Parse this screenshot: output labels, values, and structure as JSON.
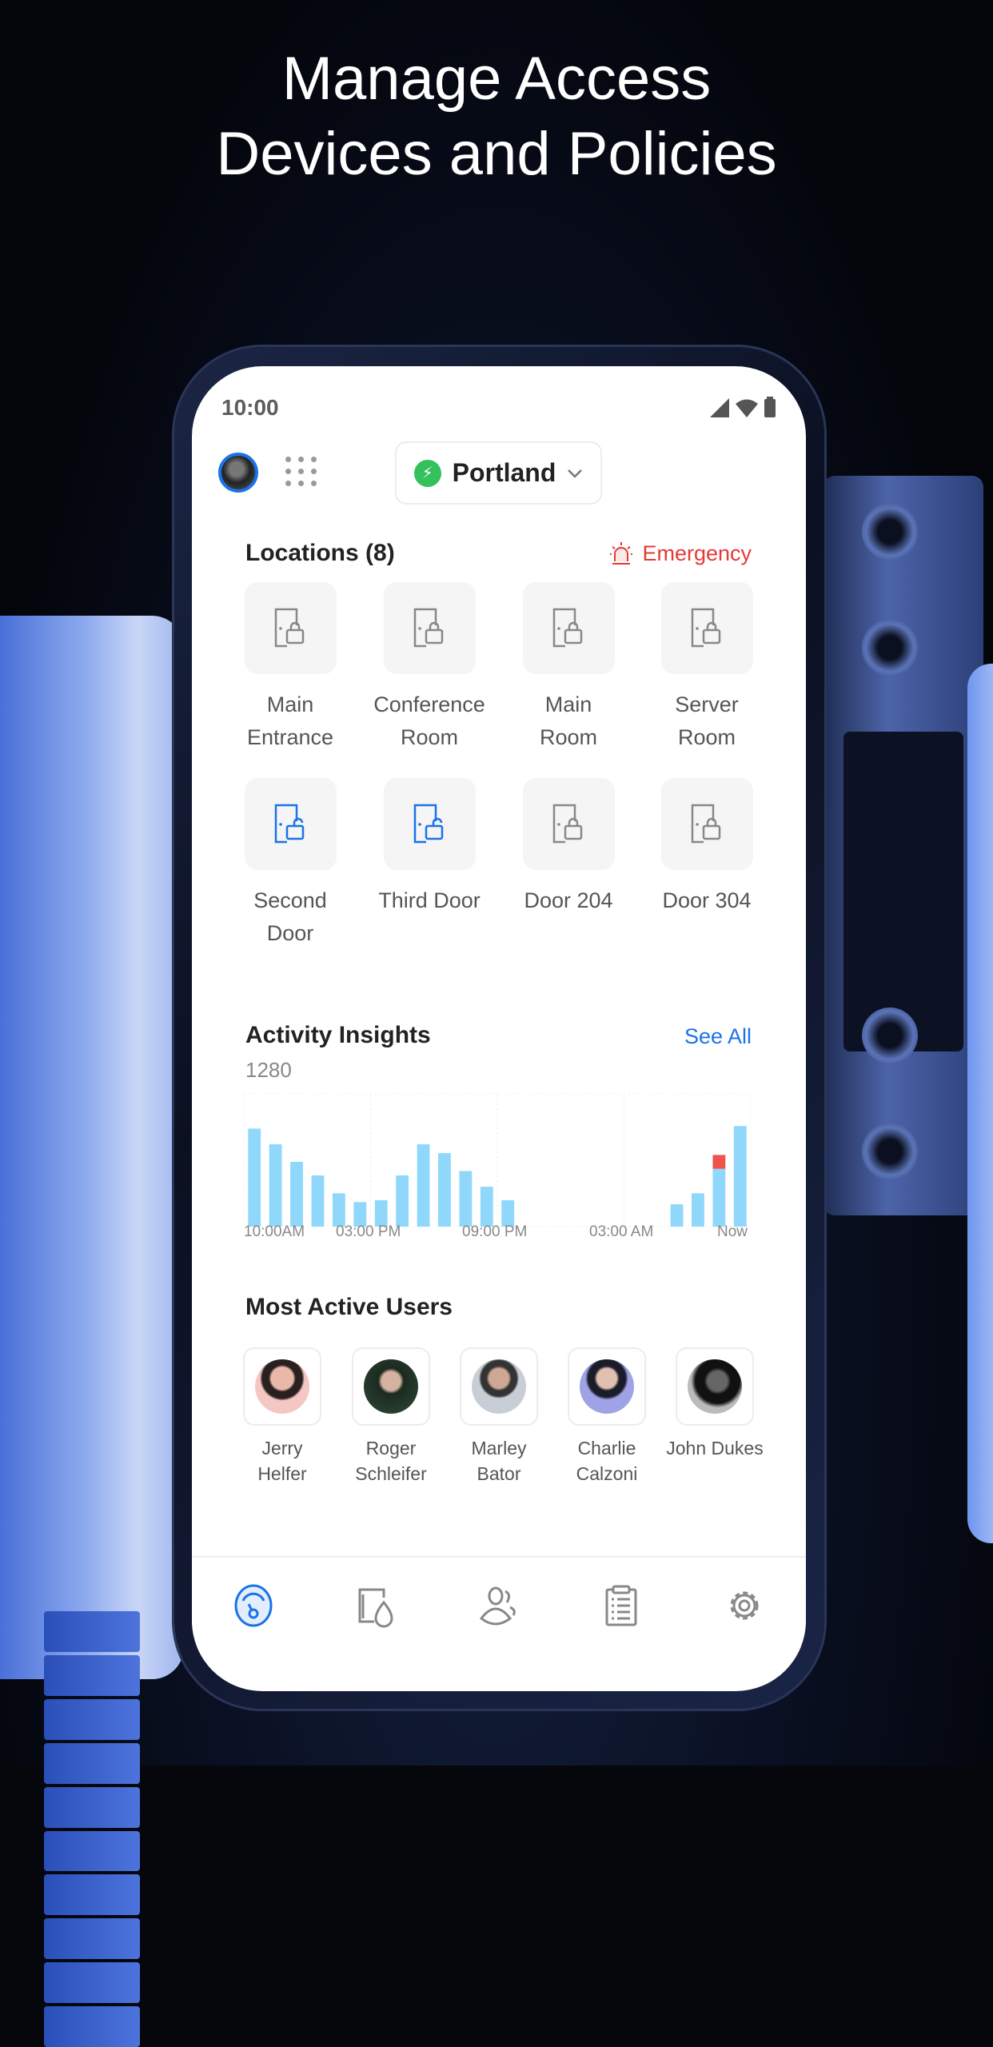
{
  "headline": {
    "line1": "Manage Access",
    "line2": "Devices and Policies"
  },
  "status_bar": {
    "time": "10:00"
  },
  "header": {
    "location": "Portland",
    "location_icon": "bolt-icon",
    "location_color": "#33c15b"
  },
  "locations": {
    "title": "Locations (8)",
    "emergency_label": "Emergency",
    "emergency_color": "#e53935",
    "items": [
      {
        "label": "Main Entrance",
        "state": "locked"
      },
      {
        "label": "Conference Room",
        "state": "locked"
      },
      {
        "label": "Main Room",
        "state": "locked"
      },
      {
        "label": "Server Room",
        "state": "locked"
      },
      {
        "label": "Second Door",
        "state": "unlocked"
      },
      {
        "label": "Third Door",
        "state": "unlocked"
      },
      {
        "label": "Door 204",
        "state": "locked"
      },
      {
        "label": "Door 304",
        "state": "locked"
      }
    ]
  },
  "activity": {
    "title": "Activity Insights",
    "see_all": "See All",
    "total": "1280"
  },
  "chart_data": {
    "type": "bar",
    "stacked": true,
    "x_tick_labels": [
      "10:00AM",
      "03:00 PM",
      "09:00 PM",
      "03:00 AM",
      "Now"
    ],
    "series": [
      {
        "color": "#8fd8fb",
        "values": [
          268,
          225,
          177,
          140,
          91,
          67,
          72,
          140,
          225,
          201,
          152,
          109,
          72,
          0,
          0,
          0,
          0,
          0,
          0,
          0,
          61,
          91,
          158,
          275
        ]
      },
      {
        "color": "#ef5350",
        "values": [
          0,
          0,
          0,
          0,
          0,
          0,
          0,
          0,
          0,
          0,
          0,
          0,
          0,
          0,
          0,
          0,
          0,
          0,
          0,
          0,
          0,
          0,
          38,
          0
        ]
      }
    ],
    "ylim": [
      0,
      363
    ],
    "grid": "vertical dashed"
  },
  "users": {
    "title": "Most Active Users",
    "items": [
      {
        "name1": "Jerry",
        "name2": "Helfer"
      },
      {
        "name1": "Roger",
        "name2": "Schleifer"
      },
      {
        "name1": "Marley",
        "name2": "Bator"
      },
      {
        "name1": "Charlie",
        "name2": "Calzoni"
      },
      {
        "name1": "John Dukes",
        "name2": ""
      }
    ]
  },
  "bottom_nav": {
    "items": [
      "dashboard-icon",
      "access-device-icon",
      "users-icon",
      "logs-icon",
      "settings-icon"
    ],
    "active_color": "#1a73e8"
  }
}
